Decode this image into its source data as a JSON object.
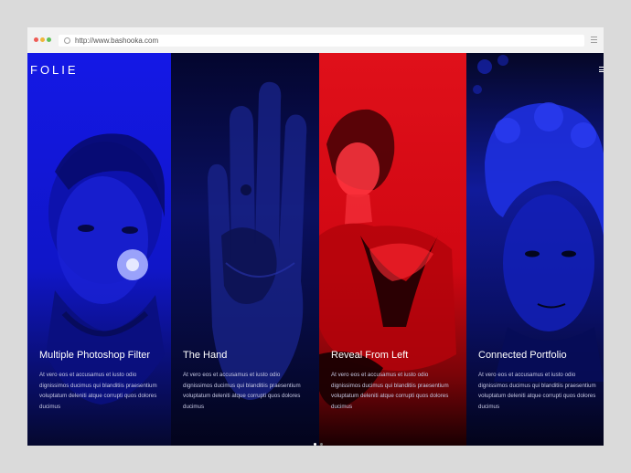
{
  "browser": {
    "url": "http://www.bashooka.com"
  },
  "site": {
    "logo": "FOLIE",
    "panels": [
      {
        "title": "Multiple Photoshop Filter",
        "text": "At vero eos et accusamus et iusto odio dignissimos ducimus qui blanditiis praesentium voluptatum deleniti atque corrupti quos dolores ducimus"
      },
      {
        "title": "The Hand",
        "text": "At vero eos et accusamus et iusto odio dignissimos ducimus qui blanditiis praesentium voluptatum deleniti atque corrupti quos dolores ducimus"
      },
      {
        "title": "Reveal From Left",
        "text": "At vero eos et accusamus et iusto odio dignissimos ducimus qui blanditiis praesentium voluptatum deleniti atque corrupti quos dolores ducimus"
      },
      {
        "title": "Connected Portfolio",
        "text": "At vero eos et accusamus et iusto odio dignissimos ducimus qui blanditiis praesentium voluptatum deleniti atque corrupti quos dolores ducimus"
      }
    ],
    "pager": {
      "count": 2,
      "active": 1
    }
  },
  "colors": {
    "blue": "#1418e6",
    "navy": "#04062e",
    "red": "#e0101a",
    "frame": "#dadada"
  }
}
